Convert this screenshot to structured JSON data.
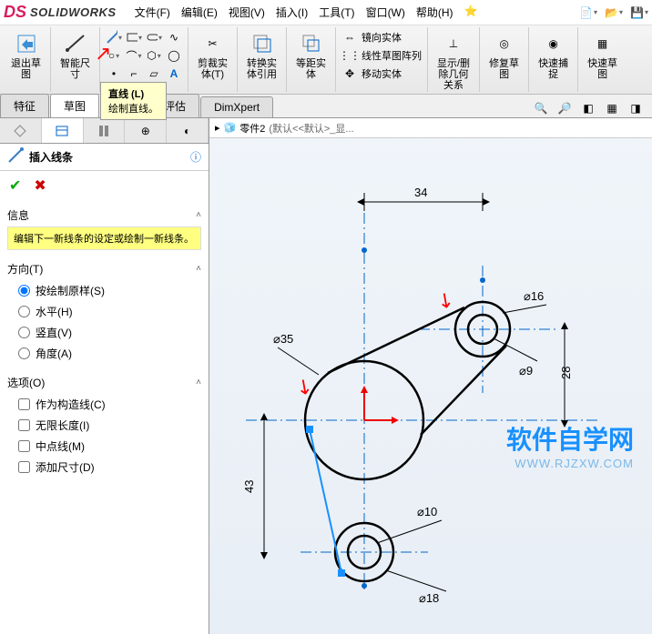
{
  "app": {
    "name": "SOLIDWORKS"
  },
  "menu": [
    "文件(F)",
    "编辑(E)",
    "视图(V)",
    "插入(I)",
    "工具(T)",
    "窗口(W)",
    "帮助(H)"
  ],
  "ribbon": {
    "exit_sketch": "退出草\n图",
    "smart_dim": "智能尺\n寸",
    "trim": "剪裁实\n体(T)",
    "convert": "转换实\n体引用",
    "offset": "等距实\n体",
    "mirror": "镜向实体",
    "linear_pattern": "线性草图阵列",
    "move": "移动实体",
    "show_del": "显示/删\n除几何\n关系",
    "repair": "修复草\n图",
    "quick_snap": "快速捕\n捉",
    "rapid": "快速草\n图"
  },
  "tooltip": {
    "title": "直线   (L)",
    "desc": "绘制直线。"
  },
  "tabs": [
    "特征",
    "草图",
    "钣金",
    "评估",
    "DimXpert"
  ],
  "panel": {
    "title": "插入线条",
    "info_head": "信息",
    "info_text": "编辑下一新线条的设定或绘制一新线条。",
    "direction_head": "方向(T)",
    "directions": {
      "by_sketch": "按绘制原样(S)",
      "horizontal": "水平(H)",
      "vertical": "竖直(V)",
      "angle": "角度(A)"
    },
    "options_head": "选项(O)",
    "options": {
      "construction": "作为构造线(C)",
      "infinite": "无限长度(I)",
      "midpoint": "中点线(M)",
      "add_dim": "添加尺寸(D)"
    }
  },
  "breadcrumb": {
    "part": "零件2",
    "config": "(默认<<默认>_显..."
  },
  "watermark": {
    "line1": "软件自学网",
    "line2": "WWW.RJZXW.COM"
  },
  "chart_data": {
    "type": "diagram",
    "dimensions": {
      "d34": 34,
      "d28": 28,
      "d43": 43,
      "phi35": 35,
      "phi16": 16,
      "phi9": 9,
      "phi10": 10,
      "phi18": 18
    }
  }
}
